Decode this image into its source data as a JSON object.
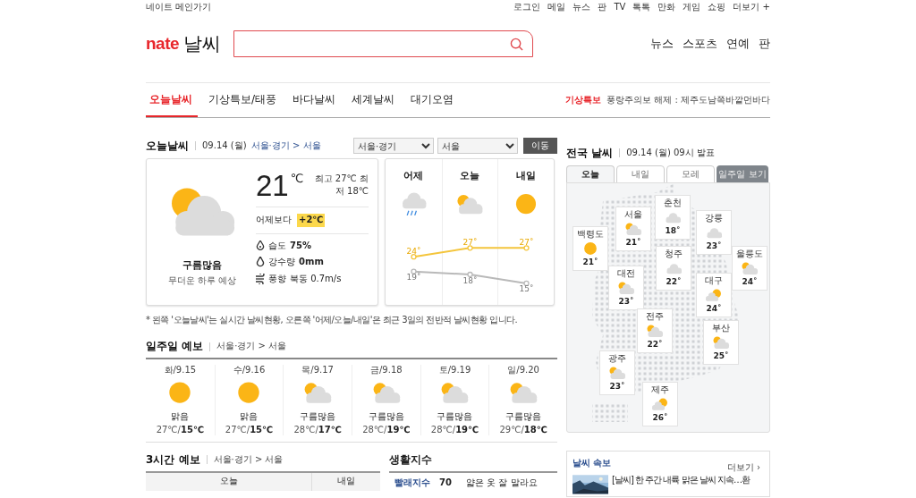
{
  "top_bar": {
    "home_link": "네이트 메인가기",
    "links": [
      "로그인",
      "메일",
      "뉴스",
      "판",
      "TV",
      "톡톡",
      "만화",
      "게임",
      "쇼핑",
      "더보기 +"
    ]
  },
  "header": {
    "logo_brand": "nate",
    "logo_title": "날씨",
    "nav": [
      "뉴스",
      "스포츠",
      "연예",
      "판"
    ]
  },
  "tabs": [
    {
      "label": "오늘날씨",
      "selected": true
    },
    {
      "label": "기상특보/태풍",
      "selected": false
    },
    {
      "label": "바다날씨",
      "selected": false
    },
    {
      "label": "세계날씨",
      "selected": false
    },
    {
      "label": "대기오염",
      "selected": false
    }
  ],
  "alert": {
    "label": "기상특보",
    "text": "풍랑주의보 해제 : 제주도남쪽바깥먼바다"
  },
  "today": {
    "title": "오늘날씨",
    "date": "09.14 (월)",
    "region": "서울·경기 > 서울",
    "selects": [
      "서울·경기",
      "서울"
    ],
    "button": "이동",
    "current": {
      "kind": "partly_cloudy",
      "condition": "구름많음",
      "summary": "무더운 하루 예상",
      "temperature": "21",
      "unit": "℃",
      "high_low": "최고 27℃ 최저 18℃",
      "compare_label": "어제보다",
      "compare_value": "+2℃",
      "details": [
        {
          "kind": "humidity",
          "label": "습도",
          "value": "75%"
        },
        {
          "kind": "rain",
          "label": "강수량",
          "value": "0mm"
        },
        {
          "kind": "wind",
          "label": "풍향",
          "value": "북동 0.7m/s"
        }
      ]
    },
    "three_days": {
      "icons": [
        {
          "kind": "rain"
        },
        {
          "kind": "partly_cloudy"
        },
        {
          "kind": "sunny"
        }
      ],
      "chart_data": {
        "type": "line",
        "categories": [
          "어제",
          "오늘",
          "내일"
        ],
        "series": [
          {
            "color": "#f4c53c",
            "values": [
              24,
              27,
              27
            ],
            "marker": "circle"
          },
          {
            "color": "#b9b9b9",
            "values": [
              19,
              18,
              15
            ],
            "marker": "circle"
          }
        ],
        "data_labels": true,
        "value_labels": [
          [
            "24˚",
            "27˚",
            "27˚"
          ],
          [
            "19˚",
            "18˚",
            "15˚"
          ]
        ]
      }
    },
    "note": "* 왼쪽 '오늘날씨'는 실시간 날씨현황, 오른쪽 '어제/오늘/내일'은 최근 3일의 전반적 날씨현황 입니다."
  },
  "weekly": {
    "title": "일주일 예보",
    "region": "서울·경기 > 서울",
    "days": [
      {
        "day": "화/9.15",
        "kind": "sunny",
        "condition": "맑음",
        "temps": "27℃/**15℃**"
      },
      {
        "day": "수/9.16",
        "kind": "sunny",
        "condition": "맑음",
        "temps": "27℃/**15℃**"
      },
      {
        "day": "목/9.17",
        "kind": "partly_cloudy",
        "condition": "구름많음",
        "temps": "28℃/**17℃**"
      },
      {
        "day": "금/9.18",
        "kind": "partly_cloudy",
        "condition": "구름많음",
        "temps": "28℃/**19℃**"
      },
      {
        "day": "토/9.19",
        "kind": "partly_cloudy",
        "condition": "구름많음",
        "temps": "28℃/**19℃**"
      },
      {
        "day": "일/9.20",
        "kind": "partly_cloudy",
        "condition": "구름많음",
        "temps": "29℃/**18℃**"
      }
    ]
  },
  "hourly": {
    "title": "3시간 예보",
    "region": "서울·경기 > 서울",
    "columns": [
      "오늘",
      "내일"
    ]
  },
  "life_index": {
    "title": "생활지수",
    "rows": [
      {
        "name": "빨래지수",
        "value": "70",
        "text": "얇은 옷 잘 말라요"
      }
    ]
  },
  "national": {
    "title": "전국 날씨",
    "issued": "09.14 (월) 09시 발표",
    "tabs": [
      {
        "label": "오늘",
        "selected": true
      },
      {
        "label": "내일",
        "selected": false
      },
      {
        "label": "모레",
        "selected": false
      }
    ],
    "week_button": "일주일 보기",
    "cities": [
      {
        "name": "춘천",
        "kind": "cloudy",
        "temp": "18˚"
      },
      {
        "name": "서울",
        "kind": "partly_cloudy",
        "temp": "21˚"
      },
      {
        "name": "강릉",
        "kind": "cloudy",
        "temp": "23˚"
      },
      {
        "name": "백령도",
        "kind": "sunny",
        "temp": "21˚"
      },
      {
        "name": "청주",
        "kind": "cloudy",
        "temp": "22˚"
      },
      {
        "name": "울릉도",
        "kind": "partly_cloudy",
        "temp": "24˚"
      },
      {
        "name": "대전",
        "kind": "partly_cloudy",
        "temp": "23˚"
      },
      {
        "name": "대구",
        "kind": "sun_cloud",
        "temp": "24˚"
      },
      {
        "name": "전주",
        "kind": "partly_cloudy",
        "temp": "22˚"
      },
      {
        "name": "부산",
        "kind": "partly_cloudy",
        "temp": "25˚"
      },
      {
        "name": "광주",
        "kind": "partly_cloudy",
        "temp": "23˚"
      },
      {
        "name": "제주",
        "kind": "sun_cloud",
        "temp": "26˚"
      }
    ]
  },
  "news": {
    "title": "날씨 속보",
    "more": "더보기 ›",
    "headline": "[날씨] 한 주간 내륙 맑은 날씨 지속…환"
  }
}
